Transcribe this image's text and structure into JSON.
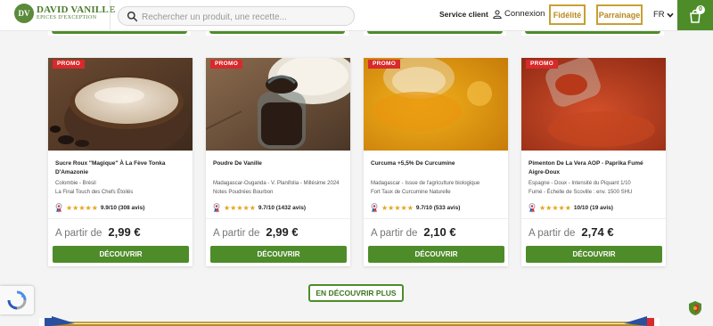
{
  "brand": {
    "initials": "DV",
    "name": "DAVID VANILLE",
    "tagline": "EPICES D'EXCEPTION"
  },
  "search": {
    "placeholder": "Rechercher un produit, une recette..."
  },
  "nav": {
    "service": "Service client",
    "connexion": "Connexion",
    "fidelite": "Fidélité",
    "parrainage": "Parrainage",
    "language": "FR"
  },
  "cart": {
    "count": "0"
  },
  "colors": {
    "brand_green": "#4e8c2a",
    "gold": "#c8a032",
    "promo_red": "#d8292b",
    "star": "#e5a31a"
  },
  "products": [
    {
      "badge": "PROMO",
      "name": "Sucre Roux \"Magique\" À La Fève Tonka D'Amazonie",
      "desc1": "Colombie - Brésil",
      "desc2": "La Final Touch des Chefs Étoilés",
      "stars": "★★★★★",
      "rating": "9.9/10 (308 avis)",
      "price_prefix": "A partir de",
      "price": "2,99 €",
      "cta": "DÉCOUVRIR"
    },
    {
      "badge": "PROMO",
      "name": "Poudre De Vanille",
      "desc1": "Madagascar-Ouganda - V. Planifolia - Millésime 2024",
      "desc2": "Notes Poudrées Bourbon",
      "stars": "★★★★★",
      "rating": "9.7/10 (1432 avis)",
      "price_prefix": "A partir de",
      "price": "2,99 €",
      "cta": "DÉCOUVRIR"
    },
    {
      "badge": "PROMO",
      "name": "Curcuma +5,5% De Curcumine",
      "desc1": "Madagascar - Issue de l'agriculture biologique",
      "desc2": "Fort Taux de Curcumine Naturelle",
      "stars": "★★★★★",
      "rating": "9.7/10 (533 avis)",
      "price_prefix": "A partir de",
      "price": "2,10 €",
      "cta": "DÉCOUVRIR"
    },
    {
      "badge": "PROMO",
      "name": "Pimenton De La Vera AOP - Paprika Fumé Aigre-Doux",
      "desc1": "Espagne - Doux - Intensité du Piquant 1/10",
      "desc2": "Fumé - Échelle de Scoville : env. 1500 SHU",
      "stars": "★★★★★",
      "rating": "10/10 (19 avis)",
      "price_prefix": "A partir de",
      "price": "2,74 €",
      "cta": "DÉCOUVRIR"
    }
  ],
  "more_button": "EN DÉCOUVRIR PLUS"
}
